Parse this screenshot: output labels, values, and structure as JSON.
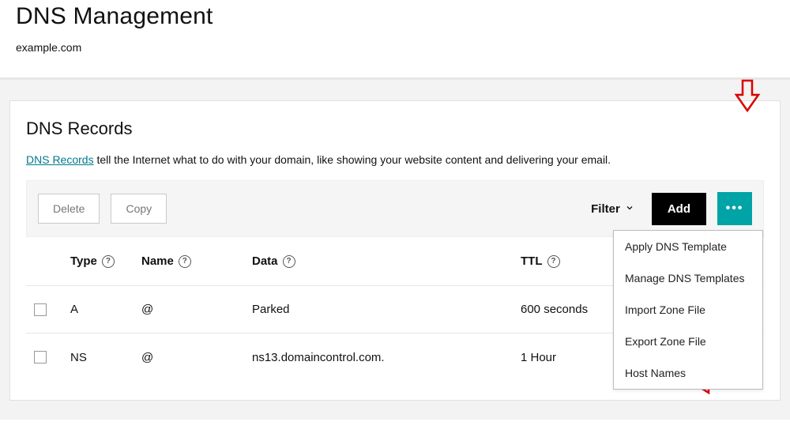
{
  "header": {
    "title": "DNS Management",
    "domain": "example.com"
  },
  "section": {
    "title": "DNS Records",
    "help_link": "DNS Records",
    "help_rest": " tell the Internet what to do with your domain, like showing your website content and delivering your email."
  },
  "toolbar": {
    "delete": "Delete",
    "copy": "Copy",
    "filter": "Filter",
    "add": "Add",
    "more": "•••"
  },
  "columns": {
    "type": "Type",
    "name": "Name",
    "data": "Data",
    "ttl": "TTL"
  },
  "rows": [
    {
      "type": "A",
      "name": "@",
      "data": "Parked",
      "ttl": "600 seconds"
    },
    {
      "type": "NS",
      "name": "@",
      "data": "ns13.domaincontrol.com.",
      "ttl": "1 Hour"
    }
  ],
  "menu": {
    "items": [
      "Apply DNS Template",
      "Manage DNS Templates",
      "Import Zone File",
      "Export Zone File",
      "Host Names"
    ]
  }
}
